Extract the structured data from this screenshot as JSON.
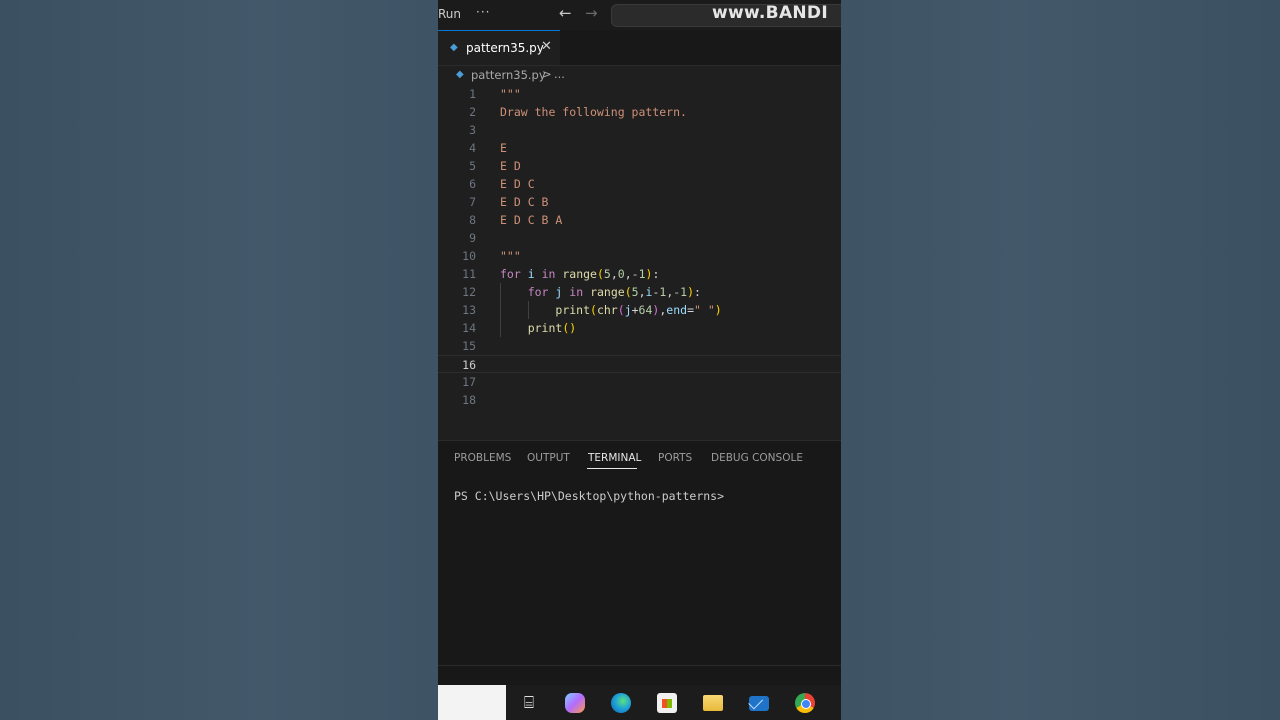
{
  "titlebar": {
    "run_menu": "Run",
    "more_menu": "···",
    "back_glyph": "←",
    "forward_glyph": "→",
    "watermark": "www.BANDI"
  },
  "tab": {
    "file_name": "pattern35.py",
    "close_glyph": "✕",
    "file_icon": "python-file-icon"
  },
  "breadcrumb": {
    "file": "pattern35.py",
    "separator": ">",
    "ellipsis": "..."
  },
  "editor": {
    "current_line": 16,
    "lines": [
      {
        "num": "1",
        "tokens": [
          {
            "t": "\"\"\"",
            "c": "c-str"
          }
        ]
      },
      {
        "num": "2",
        "tokens": [
          {
            "t": "Draw the following pattern.",
            "c": "c-str"
          }
        ]
      },
      {
        "num": "3",
        "tokens": []
      },
      {
        "num": "4",
        "tokens": [
          {
            "t": "E",
            "c": "c-str"
          }
        ]
      },
      {
        "num": "5",
        "tokens": [
          {
            "t": "E D",
            "c": "c-str"
          }
        ]
      },
      {
        "num": "6",
        "tokens": [
          {
            "t": "E D C",
            "c": "c-str"
          }
        ]
      },
      {
        "num": "7",
        "tokens": [
          {
            "t": "E D C B",
            "c": "c-str"
          }
        ]
      },
      {
        "num": "8",
        "tokens": [
          {
            "t": "E D C B A",
            "c": "c-str"
          }
        ]
      },
      {
        "num": "9",
        "tokens": []
      },
      {
        "num": "10",
        "tokens": [
          {
            "t": "\"\"\"",
            "c": "c-str"
          }
        ]
      },
      {
        "num": "11",
        "tokens": [
          {
            "t": "for",
            "c": "c-kw"
          },
          {
            "t": " ",
            "c": "c-plain"
          },
          {
            "t": "i",
            "c": "c-var"
          },
          {
            "t": " in ",
            "c": "c-kw"
          },
          {
            "t": "range",
            "c": "c-fn"
          },
          {
            "t": "(",
            "c": "c-br1"
          },
          {
            "t": "5",
            "c": "c-num"
          },
          {
            "t": ",",
            "c": "c-plain"
          },
          {
            "t": "0",
            "c": "c-num"
          },
          {
            "t": ",",
            "c": "c-plain"
          },
          {
            "t": "-1",
            "c": "c-num"
          },
          {
            "t": ")",
            "c": "c-br1"
          },
          {
            "t": ":",
            "c": "c-plain"
          }
        ]
      },
      {
        "num": "12",
        "tokens": [
          {
            "t": "    ",
            "c": "c-plain"
          },
          {
            "t": "for",
            "c": "c-kw"
          },
          {
            "t": " ",
            "c": "c-plain"
          },
          {
            "t": "j",
            "c": "c-var"
          },
          {
            "t": " in ",
            "c": "c-kw"
          },
          {
            "t": "range",
            "c": "c-fn"
          },
          {
            "t": "(",
            "c": "c-br1"
          },
          {
            "t": "5",
            "c": "c-num"
          },
          {
            "t": ",",
            "c": "c-plain"
          },
          {
            "t": "i",
            "c": "c-var"
          },
          {
            "t": "-",
            "c": "c-plain"
          },
          {
            "t": "1",
            "c": "c-num"
          },
          {
            "t": ",",
            "c": "c-plain"
          },
          {
            "t": "-1",
            "c": "c-num"
          },
          {
            "t": ")",
            "c": "c-br1"
          },
          {
            "t": ":",
            "c": "c-plain"
          }
        ]
      },
      {
        "num": "13",
        "tokens": [
          {
            "t": "        ",
            "c": "c-plain"
          },
          {
            "t": "print",
            "c": "c-fn"
          },
          {
            "t": "(",
            "c": "c-br1"
          },
          {
            "t": "chr",
            "c": "c-fn"
          },
          {
            "t": "(",
            "c": "c-br2"
          },
          {
            "t": "j",
            "c": "c-var"
          },
          {
            "t": "+",
            "c": "c-plain"
          },
          {
            "t": "64",
            "c": "c-num"
          },
          {
            "t": ")",
            "c": "c-br2"
          },
          {
            "t": ",",
            "c": "c-plain"
          },
          {
            "t": "end",
            "c": "c-var"
          },
          {
            "t": "=",
            "c": "c-plain"
          },
          {
            "t": "\" \"",
            "c": "c-str"
          },
          {
            "t": ")",
            "c": "c-br1"
          }
        ]
      },
      {
        "num": "14",
        "tokens": [
          {
            "t": "    ",
            "c": "c-plain"
          },
          {
            "t": "print",
            "c": "c-fn"
          },
          {
            "t": "()",
            "c": "c-br1"
          }
        ]
      },
      {
        "num": "15",
        "tokens": []
      },
      {
        "num": "16",
        "tokens": []
      },
      {
        "num": "17",
        "tokens": []
      },
      {
        "num": "18",
        "tokens": []
      }
    ]
  },
  "panel": {
    "tabs": [
      {
        "label": "PROBLEMS",
        "active": false
      },
      {
        "label": "OUTPUT",
        "active": false
      },
      {
        "label": "TERMINAL",
        "active": true
      },
      {
        "label": "PORTS",
        "active": false
      },
      {
        "label": "DEBUG CONSOLE",
        "active": false
      }
    ],
    "terminal_prompt": "PS C:\\Users\\HP\\Desktop\\python-patterns>"
  },
  "taskbar": {
    "icons": [
      "task-view-icon",
      "copilot-icon",
      "edge-icon",
      "store-icon",
      "file-explorer-icon",
      "mail-icon",
      "chrome-icon"
    ]
  },
  "colors": {
    "accent": "#0078d4",
    "editor_bg": "#1f1f1f",
    "panel_bg": "#181818",
    "string": "#ce9178",
    "keyword": "#c586c0",
    "function": "#dcdcaa"
  }
}
